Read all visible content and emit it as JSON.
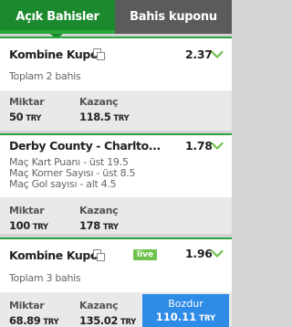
{
  "colors": {
    "brand_green": "#1b8a2e",
    "accent_green": "#2aa63c",
    "tab_gray": "#5b5b5b",
    "live_green": "#6fc14d",
    "cashout_blue": "#2e8be6"
  },
  "tabs": {
    "open_bets": "Açık Bahisler",
    "bet_slip": "Bahis kuponu"
  },
  "cards": [
    {
      "title": "Kombine Kupon",
      "odds": "2.37",
      "subtitle": "Toplam 2 bahis",
      "stake_label": "Miktar",
      "stake_value": "50",
      "stake_currency": "TRY",
      "return_label": "Kazanç",
      "return_value": "118.5",
      "return_currency": "TRY"
    },
    {
      "title": "Derby County - Charlto...",
      "odds": "1.78",
      "selections": [
        "Maç Kart Puanı - üst 19.5",
        "Maç Korner Sayısı - üst 8.5",
        "Maç Gol sayısı - alt 4.5"
      ],
      "stake_label": "Miktar",
      "stake_value": "100",
      "stake_currency": "TRY",
      "return_label": "Kazanç",
      "return_value": "178",
      "return_currency": "TRY"
    },
    {
      "title": "Kombine Kupon",
      "live": "live",
      "odds": "1.96",
      "subtitle": "Toplam 3 bahis",
      "stake_label": "Miktar",
      "stake_value": "68.89",
      "stake_currency": "TRY",
      "return_label": "Kazanç",
      "return_value": "135.02",
      "return_currency": "TRY",
      "cashout_label": "Bozdur",
      "cashout_value": "110.11",
      "cashout_currency": "TRY"
    }
  ]
}
